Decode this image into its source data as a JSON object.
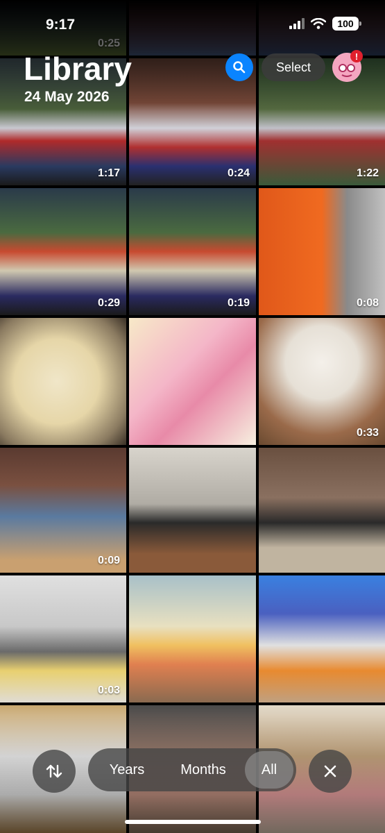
{
  "status": {
    "time": "9:17",
    "battery": "100"
  },
  "header": {
    "title": "Library",
    "date": "24 May 2026",
    "select_label": "Select",
    "badge": "!"
  },
  "tiles": [
    {
      "duration": "0:25"
    },
    {
      "duration": ""
    },
    {
      "duration": ""
    },
    {
      "duration": "1:17"
    },
    {
      "duration": "0:24"
    },
    {
      "duration": "1:22"
    },
    {
      "duration": "0:29"
    },
    {
      "duration": "0:19"
    },
    {
      "duration": "0:08"
    },
    {
      "duration": ""
    },
    {
      "duration": ""
    },
    {
      "duration": "0:33"
    },
    {
      "duration": "0:09"
    },
    {
      "duration": ""
    },
    {
      "duration": ""
    },
    {
      "duration": "0:03"
    },
    {
      "duration": ""
    },
    {
      "duration": ""
    }
  ],
  "toolbar": {
    "years": "Years",
    "months": "Months",
    "all": "All",
    "active": "All"
  },
  "colors": {
    "accent": "#0a84ff",
    "badge": "#e0202d"
  }
}
